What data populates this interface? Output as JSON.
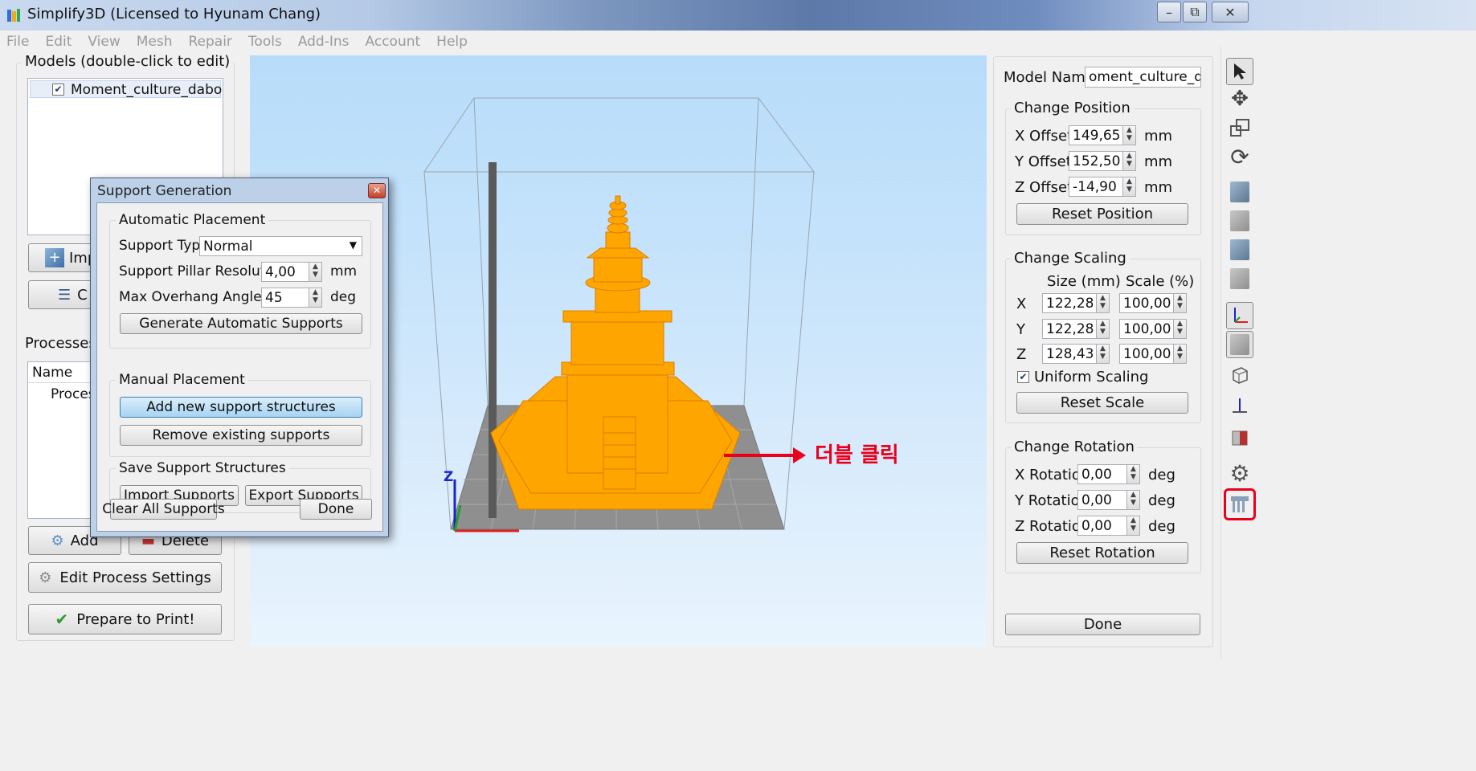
{
  "window": {
    "title": "Simplify3D (Licensed to Hyunam Chang)",
    "min": "–",
    "max": "⧉",
    "close": "✕"
  },
  "menu": [
    "File",
    "Edit",
    "View",
    "Mesh",
    "Repair",
    "Tools",
    "Add-Ins",
    "Account",
    "Help"
  ],
  "models": {
    "title": "Models (double-click to edit)",
    "items": [
      {
        "name": "Moment_culture_dabo",
        "checked": true
      }
    ],
    "import_label": "Imp",
    "center_label": "C"
  },
  "processes": {
    "title": "Processes",
    "column": "Name",
    "items": [
      "Process"
    ],
    "add_label": "Add",
    "delete_label": "Delete",
    "edit_label": "Edit Process Settings",
    "prepare_label": "Prepare to Print!"
  },
  "dialog": {
    "title": "Support Generation",
    "auto": {
      "title": "Automatic Placement",
      "type_label": "Support Type",
      "type_value": "Normal",
      "res_label": "Support Pillar Resolution",
      "res_value": "4,00",
      "res_unit": "mm",
      "angle_label": "Max Overhang Angle",
      "angle_value": "45",
      "angle_unit": "deg",
      "generate": "Generate Automatic Supports"
    },
    "manual": {
      "title": "Manual Placement",
      "add": "Add new support structures",
      "remove": "Remove existing supports"
    },
    "save": {
      "title": "Save Support Structures",
      "import": "Import Supports",
      "export": "Export Supports"
    },
    "clear": "Clear All Supports",
    "done": "Done"
  },
  "viewport": {
    "annotation": "더블 클릭",
    "axis_z": "Z"
  },
  "right": {
    "model_name_label": "Model Name:",
    "model_name_value": "oment_culture_dabo",
    "position": {
      "title": "Change Position",
      "rows": [
        {
          "label": "X Offset",
          "value": "149,65",
          "unit": "mm"
        },
        {
          "label": "Y Offset",
          "value": "152,50",
          "unit": "mm"
        },
        {
          "label": "Z Offset",
          "value": "-14,90",
          "unit": "mm"
        }
      ],
      "reset": "Reset Position"
    },
    "scaling": {
      "title": "Change Scaling",
      "size_header": "Size (mm)",
      "scale_header": "Scale (%)",
      "rows": [
        {
          "axis": "X",
          "size": "122,28",
          "scale": "100,00"
        },
        {
          "axis": "Y",
          "size": "122,28",
          "scale": "100,00"
        },
        {
          "axis": "Z",
          "size": "128,43",
          "scale": "100,00"
        }
      ],
      "uniform": "Uniform Scaling",
      "reset": "Reset Scale"
    },
    "rotation": {
      "title": "Change Rotation",
      "rows": [
        {
          "label": "X Rotation",
          "value": "0,00",
          "unit": "deg"
        },
        {
          "label": "Y Rotation",
          "value": "0,00",
          "unit": "deg"
        },
        {
          "label": "Z Rotation",
          "value": "0,00",
          "unit": "deg"
        }
      ],
      "reset": "Reset Rotation"
    },
    "done": "Done"
  },
  "colors": {
    "model": "#ffa500",
    "highlight": "#e8001c",
    "arrow": "#e8001c"
  },
  "toolbar_icons": [
    "select-arrow-icon",
    "move-icon",
    "scale-icon",
    "rotate-icon",
    "view-iso-icon",
    "view-front-icon",
    "view-side-icon",
    "view-top-icon",
    "axes-icon",
    "solid-view-icon",
    "wireframe-icon",
    "normal-icon",
    "cross-section-icon",
    "settings-gear-icon",
    "support-generation-icon"
  ]
}
